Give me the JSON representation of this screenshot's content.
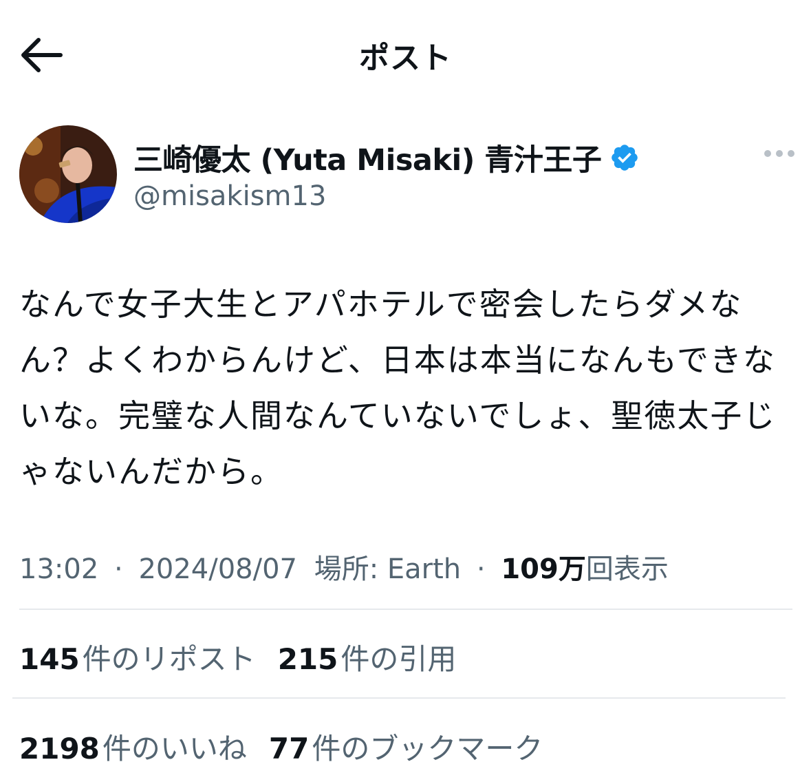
{
  "header": {
    "title": "ポスト"
  },
  "author": {
    "display_name": "三崎優太 (Yuta Misaki) 青汁王子",
    "handle": "@misakism13",
    "verified": true
  },
  "tweet": {
    "text": "なんで女子大生とアパホテルで密会したらダメなん？よくわからんけど、日本は本当になんもできないな。完璧な人間なんていないでしょ、聖徳太子じゃないんだから。"
  },
  "meta": {
    "time": "13:02",
    "date": "2024/08/07",
    "location": "場所: Earth",
    "views_count": "109万",
    "views_label": "回表示",
    "separator": "·"
  },
  "stats": {
    "reposts": {
      "count": "145",
      "label": "件のリポスト"
    },
    "quotes": {
      "count": "215",
      "label": "件の引用"
    },
    "likes": {
      "count": "2198",
      "label": "件のいいね"
    },
    "bookmarks": {
      "count": "77",
      "label": "件のブックマーク"
    }
  },
  "colors": {
    "text": "#0f1419",
    "secondary": "#536471",
    "verified_blue": "#1d9bf0",
    "divider": "#e6e9ec"
  },
  "icons": [
    "back-arrow-icon",
    "verified-badge-icon",
    "more-options-icon"
  ]
}
